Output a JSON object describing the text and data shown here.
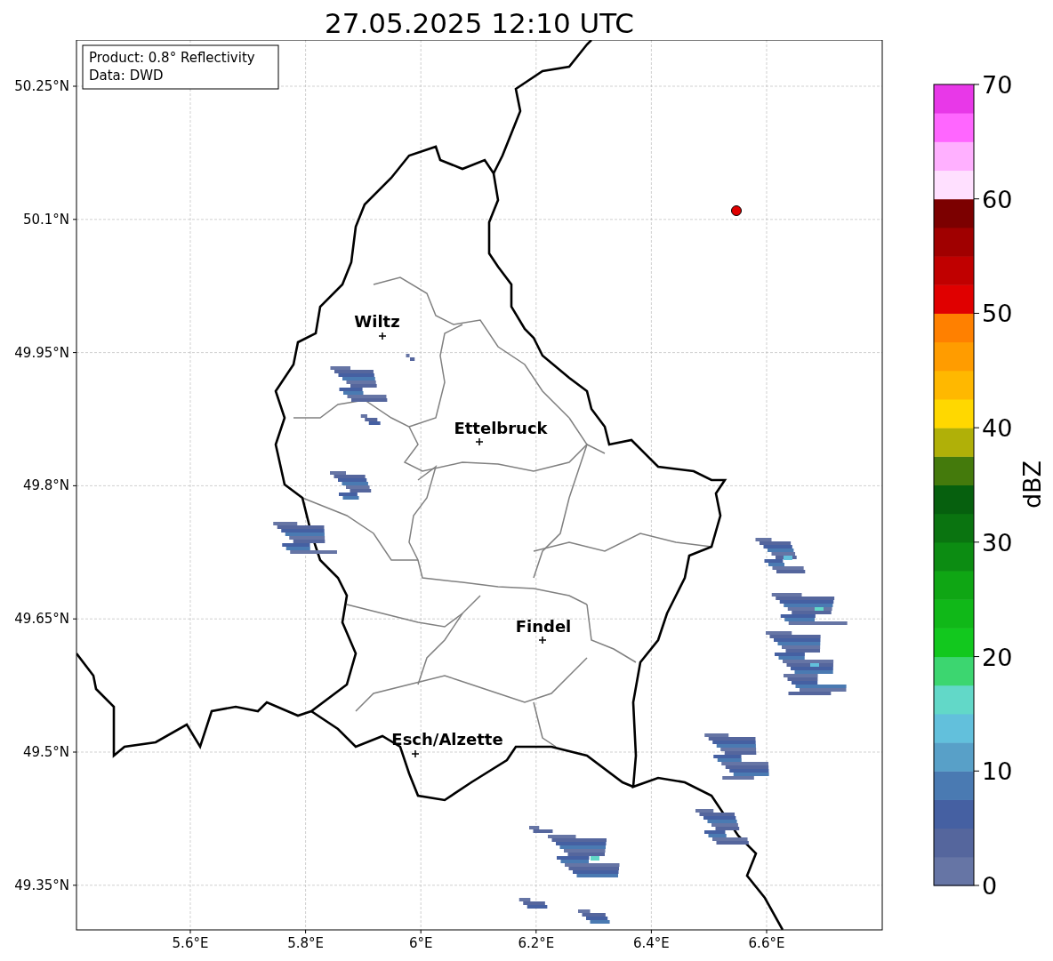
{
  "title": "27.05.2025 12:10 UTC",
  "info_box": {
    "lines": [
      "Product: 0.8° Reflectivity",
      "Data: DWD"
    ]
  },
  "map": {
    "lat_ticks": [
      "50.25°N",
      "50.1°N",
      "49.95°N",
      "49.8°N",
      "49.65°N",
      "49.5°N",
      "49.35°N"
    ],
    "lon_ticks": [
      "5.6°E",
      "5.8°E",
      "6°E",
      "6.2°E",
      "6.4°E",
      "6.6°E"
    ],
    "cities": [
      {
        "name": "Wiltz"
      },
      {
        "name": "Ettelbruck"
      },
      {
        "name": "Findel"
      },
      {
        "name": "Esch/Alzette"
      }
    ]
  },
  "colorbar": {
    "label": "dBZ",
    "ticks": [
      "70",
      "60",
      "50",
      "40",
      "30",
      "20",
      "10",
      "0"
    ],
    "bins": [
      {
        "color": "#6675a5"
      },
      {
        "color": "#55669d"
      },
      {
        "color": "#4560a2"
      },
      {
        "color": "#4a7ab2"
      },
      {
        "color": "#58a0c8"
      },
      {
        "color": "#62c0dc"
      },
      {
        "color": "#62d8c8"
      },
      {
        "color": "#3cd670"
      },
      {
        "color": "#12c81e"
      },
      {
        "color": "#10b818"
      },
      {
        "color": "#0fa614"
      },
      {
        "color": "#0c8c12"
      },
      {
        "color": "#0a7410"
      },
      {
        "color": "#06600e"
      },
      {
        "color": "#447a0c"
      },
      {
        "color": "#b0b008"
      },
      {
        "color": "#ffd800"
      },
      {
        "color": "#ffb800"
      },
      {
        "color": "#ff9c00"
      },
      {
        "color": "#ff8000"
      },
      {
        "color": "#e00000"
      },
      {
        "color": "#c00000"
      },
      {
        "color": "#a00000"
      },
      {
        "color": "#7c0000"
      },
      {
        "color": "#ffe0ff"
      },
      {
        "color": "#ffb0ff"
      },
      {
        "color": "#ff66ff"
      },
      {
        "color": "#e838e8"
      }
    ]
  }
}
